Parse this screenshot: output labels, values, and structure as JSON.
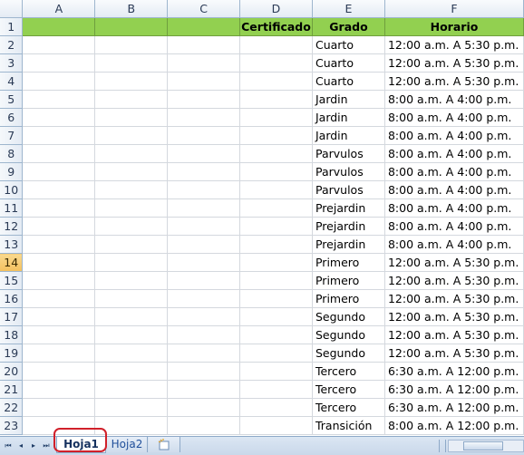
{
  "columns": [
    "A",
    "B",
    "C",
    "D",
    "E",
    "F"
  ],
  "header_row": {
    "row_num": "1",
    "cells": [
      "",
      "",
      "",
      "Certificado",
      "Grado",
      "Horario"
    ]
  },
  "rows": [
    {
      "n": "2",
      "grado": "Cuarto",
      "horario": "12:00 a.m. A 5:30 p.m."
    },
    {
      "n": "3",
      "grado": "Cuarto",
      "horario": "12:00 a.m. A 5:30 p.m."
    },
    {
      "n": "4",
      "grado": "Cuarto",
      "horario": "12:00 a.m. A 5:30 p.m."
    },
    {
      "n": "5",
      "grado": "Jardin",
      "horario": "8:00 a.m. A 4:00 p.m."
    },
    {
      "n": "6",
      "grado": "Jardin",
      "horario": "8:00 a.m. A 4:00 p.m."
    },
    {
      "n": "7",
      "grado": "Jardin",
      "horario": "8:00 a.m. A 4:00 p.m."
    },
    {
      "n": "8",
      "grado": "Parvulos",
      "horario": "8:00 a.m. A 4:00 p.m."
    },
    {
      "n": "9",
      "grado": "Parvulos",
      "horario": "8:00 a.m. A 4:00 p.m."
    },
    {
      "n": "10",
      "grado": "Parvulos",
      "horario": "8:00 a.m. A 4:00 p.m."
    },
    {
      "n": "11",
      "grado": "Prejardin",
      "horario": "8:00 a.m. A 4:00 p.m."
    },
    {
      "n": "12",
      "grado": "Prejardin",
      "horario": "8:00 a.m. A 4:00 p.m."
    },
    {
      "n": "13",
      "grado": "Prejardin",
      "horario": "8:00 a.m. A 4:00 p.m."
    },
    {
      "n": "14",
      "grado": "Primero",
      "horario": "12:00 a.m. A 5:30 p.m.",
      "active": true
    },
    {
      "n": "15",
      "grado": "Primero",
      "horario": "12:00 a.m. A 5:30 p.m."
    },
    {
      "n": "16",
      "grado": "Primero",
      "horario": "12:00 a.m. A 5:30 p.m."
    },
    {
      "n": "17",
      "grado": "Segundo",
      "horario": "12:00 a.m. A 5:30 p.m."
    },
    {
      "n": "18",
      "grado": "Segundo",
      "horario": "12:00 a.m. A 5:30 p.m."
    },
    {
      "n": "19",
      "grado": "Segundo",
      "horario": "12:00 a.m. A 5:30 p.m."
    },
    {
      "n": "20",
      "grado": "Tercero",
      "horario": "6:30 a.m. A 12:00 p.m."
    },
    {
      "n": "21",
      "grado": "Tercero",
      "horario": "6:30 a.m. A 12:00 p.m."
    },
    {
      "n": "22",
      "grado": "Tercero",
      "horario": "6:30 a.m. A 12:00 p.m."
    },
    {
      "n": "23",
      "grado": "Transición",
      "horario": "8:00 a.m. A 12:00 p.m."
    }
  ],
  "sheet_tabs": {
    "active": "Hoja1",
    "others": [
      "Hoja2"
    ],
    "insert_icon": "insert-sheet-icon"
  },
  "nav_buttons": [
    "first-sheet-icon",
    "prev-sheet-icon",
    "next-sheet-icon",
    "last-sheet-icon"
  ],
  "nav_glyphs": [
    "⏮",
    "◂",
    "▸",
    "⏭"
  ],
  "colors": {
    "header_fill": "#92d050",
    "active_row_header": "#f4c05e",
    "highlight_outline": "#d0202a"
  }
}
